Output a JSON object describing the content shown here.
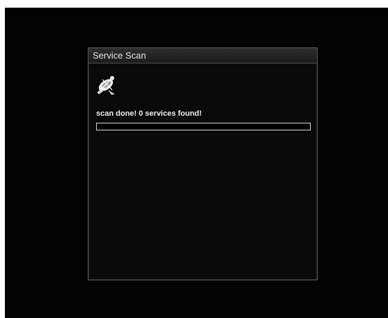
{
  "dialog": {
    "title": "Service Scan",
    "icon": "satellite-dish-icon",
    "status": "scan done! 0 services found!",
    "progress": 0
  },
  "colors": {
    "screen_background": "#030303",
    "dialog_background": "#0a0a0a",
    "title_bar": "#2a2a2a",
    "text": "#f0f0f0",
    "progress_border": "#d8d8d8"
  }
}
